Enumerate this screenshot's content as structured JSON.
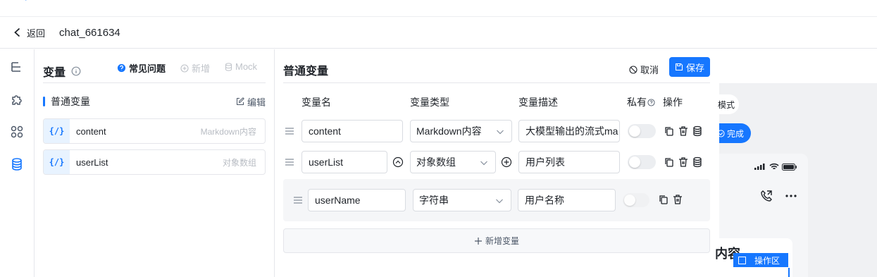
{
  "header": {
    "back_label": "返回",
    "chat_title": "chat_661634"
  },
  "variables_panel": {
    "title": "变量",
    "faq_label": "常见问题",
    "add_label": "新增",
    "mock_label": "Mock",
    "section_title": "普通变量",
    "edit_label": "编辑",
    "items": [
      {
        "badge": "{/}",
        "name": "content",
        "type": "Markdown内容"
      },
      {
        "badge": "{/}",
        "name": "userList",
        "type": "对象数组"
      }
    ]
  },
  "editor": {
    "title": "普通变量",
    "cancel_label": "取消",
    "save_label": "保存",
    "columns": [
      "变量名",
      "变量类型",
      "变量描述",
      "私有",
      "操作"
    ],
    "rows": [
      {
        "name": "content",
        "type": "Markdown内容",
        "description": "大模型输出的流式ma",
        "private": false
      },
      {
        "name": "userList",
        "type": "对象数组",
        "description": "用户列表",
        "private": false
      },
      {
        "name": "userName",
        "type": "字符串",
        "description": "用户名称",
        "private": false
      }
    ],
    "add_variable_label": "新增变量"
  },
  "preview": {
    "mode_label": "模式",
    "done_label": "完成",
    "card_title": "内容",
    "operation_zone_label": "操作区"
  },
  "colors": {
    "accent": "#1677ff",
    "badge_bg": "#e8f3ff",
    "border": "#e5e6eb"
  }
}
